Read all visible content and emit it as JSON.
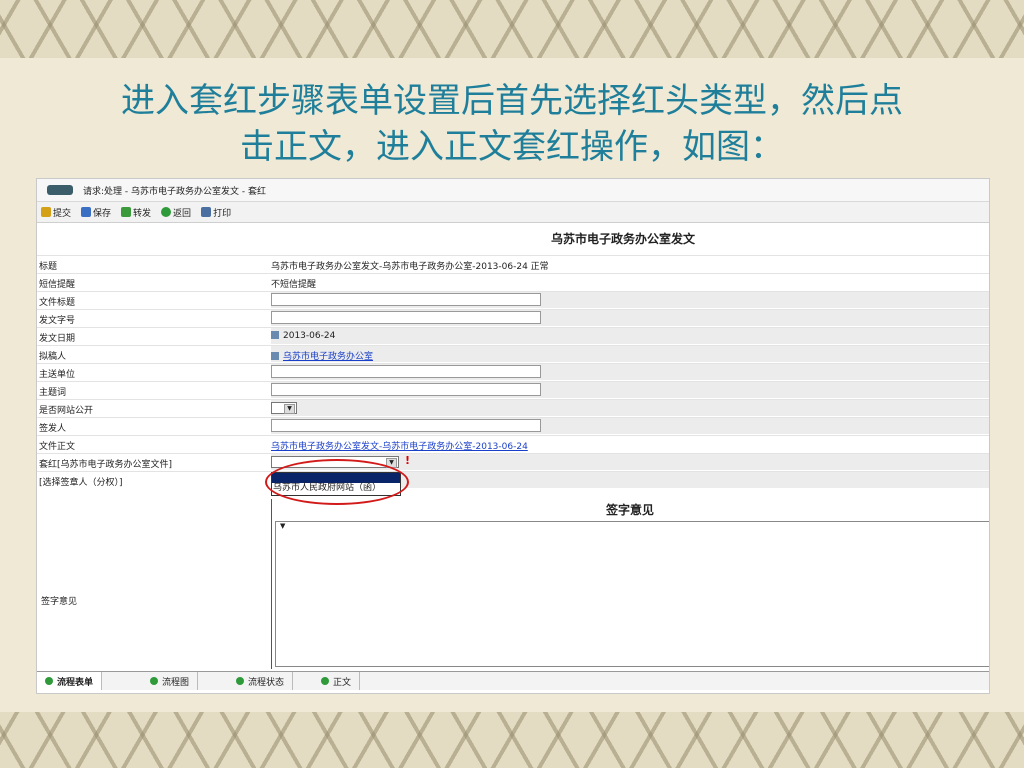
{
  "slide": {
    "title_line1": "进入套红步骤表单设置后首先选择红头类型，然后点",
    "title_line2": "击正文，进入正文套红操作，如图："
  },
  "window": {
    "title": "请求:处理 - 乌苏市电子政务办公室发文 - 套红"
  },
  "toolbar": [
    {
      "label": "提交",
      "icon": "submit-icon",
      "color": "#d4a017"
    },
    {
      "label": "保存",
      "icon": "save-icon",
      "color": "#3b6fc4"
    },
    {
      "label": "转发",
      "icon": "forward-icon",
      "color": "#3b9a3b"
    },
    {
      "label": "返回",
      "icon": "back-icon",
      "color": "#2f9a3a"
    },
    {
      "label": "打印",
      "icon": "print-icon",
      "color": "#4a6fa0"
    }
  ],
  "form": {
    "header": "乌苏市电子政务办公室发文",
    "fields": {
      "title": {
        "label": "标题",
        "value": "乌苏市电子政务办公室发文-乌苏市电子政务办公室-2013-06-24  正常"
      },
      "sms": {
        "label": "短信提醒",
        "value": "不短信提醒"
      },
      "doc_title": {
        "label": "文件标题",
        "value": ""
      },
      "doc_no": {
        "label": "发文字号",
        "value": ""
      },
      "date": {
        "label": "发文日期",
        "value": "2013-06-24"
      },
      "drafter": {
        "label": "拟稿人",
        "value": "乌苏市电子政务办公室"
      },
      "main_unit": {
        "label": "主送单位",
        "value": ""
      },
      "keywords": {
        "label": "主题词",
        "value": ""
      },
      "public": {
        "label": "是否网站公开",
        "value": ""
      },
      "signer": {
        "label": "签发人",
        "value": ""
      },
      "body": {
        "label": "文件正文",
        "value": "乌苏市电子政务办公室发文-乌苏市电子政务办公室-2013-06-24"
      },
      "redhead": {
        "label": "套红[乌苏市电子政务办公室文件]",
        "value": "",
        "required_mark": "!"
      },
      "seal": {
        "label": "[选择签章人（分权）]"
      }
    },
    "dropdown_options": [
      "",
      "乌苏市人民政府网站（函）"
    ],
    "signature": {
      "title": "签字意见",
      "label": "签字意见",
      "value": ""
    }
  },
  "tabs": [
    {
      "label": "流程表单",
      "active": true
    },
    {
      "label": "流程图",
      "active": false
    },
    {
      "label": "流程状态",
      "active": false
    },
    {
      "label": "正文",
      "active": false
    }
  ],
  "colors": {
    "title": "#1f7f9a",
    "highlight_ring": "#d21a1a",
    "link": "#1a3fc9"
  }
}
